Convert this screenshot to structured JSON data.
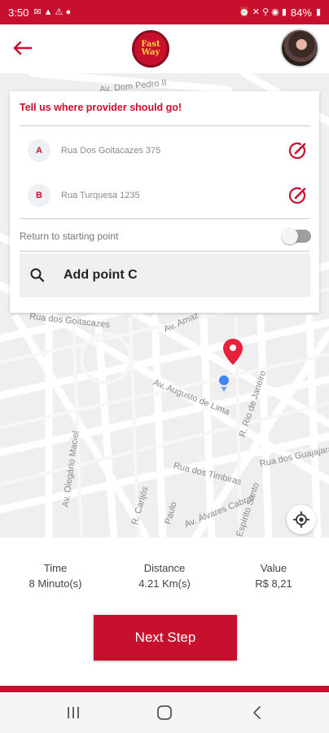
{
  "status": {
    "time": "3:50",
    "battery": "84%"
  },
  "header": {
    "logo_text_1": "Fast",
    "logo_text_2": "Way"
  },
  "map": {
    "streets": {
      "dom_pedro": "Av. Dom Pedro II",
      "goitacazes": "Rua dos Goitacazes",
      "amazonas": "Av. Amaz",
      "augusto": "Av. Augusto de Lima",
      "rio_janeiro": "R. Rio de Janeiro",
      "olegario": "Av. Olegário Maciel",
      "timbiras": "Rua dos Timbiras",
      "carijos": "R. Carijós",
      "alvares": "Av. Álvares Cabral",
      "espirito": "Espírito Santo",
      "guajajaras": "Rua dos Guajajaras",
      "paulo": "Paulo"
    }
  },
  "form": {
    "title": "Tell us where provider should go!",
    "stops": [
      {
        "letter": "A",
        "address": "Rua Dos Goitacazes 375"
      },
      {
        "letter": "B",
        "address": "Rua Turquesa 1235"
      }
    ],
    "return_label": "Return to starting point",
    "return_on": false,
    "add_point_label": "Add point  C"
  },
  "summary": {
    "time_label": "Time",
    "time_value": "8 Minuto(s)",
    "distance_label": "Distance",
    "distance_value": "4.21 Km(s)",
    "value_label": "Value",
    "value_value": "R$ 8,21"
  },
  "actions": {
    "next_label": "Next Step"
  },
  "colors": {
    "accent": "#c8102e",
    "pin_red": "#e8203a",
    "pin_blue": "#4285f4"
  }
}
